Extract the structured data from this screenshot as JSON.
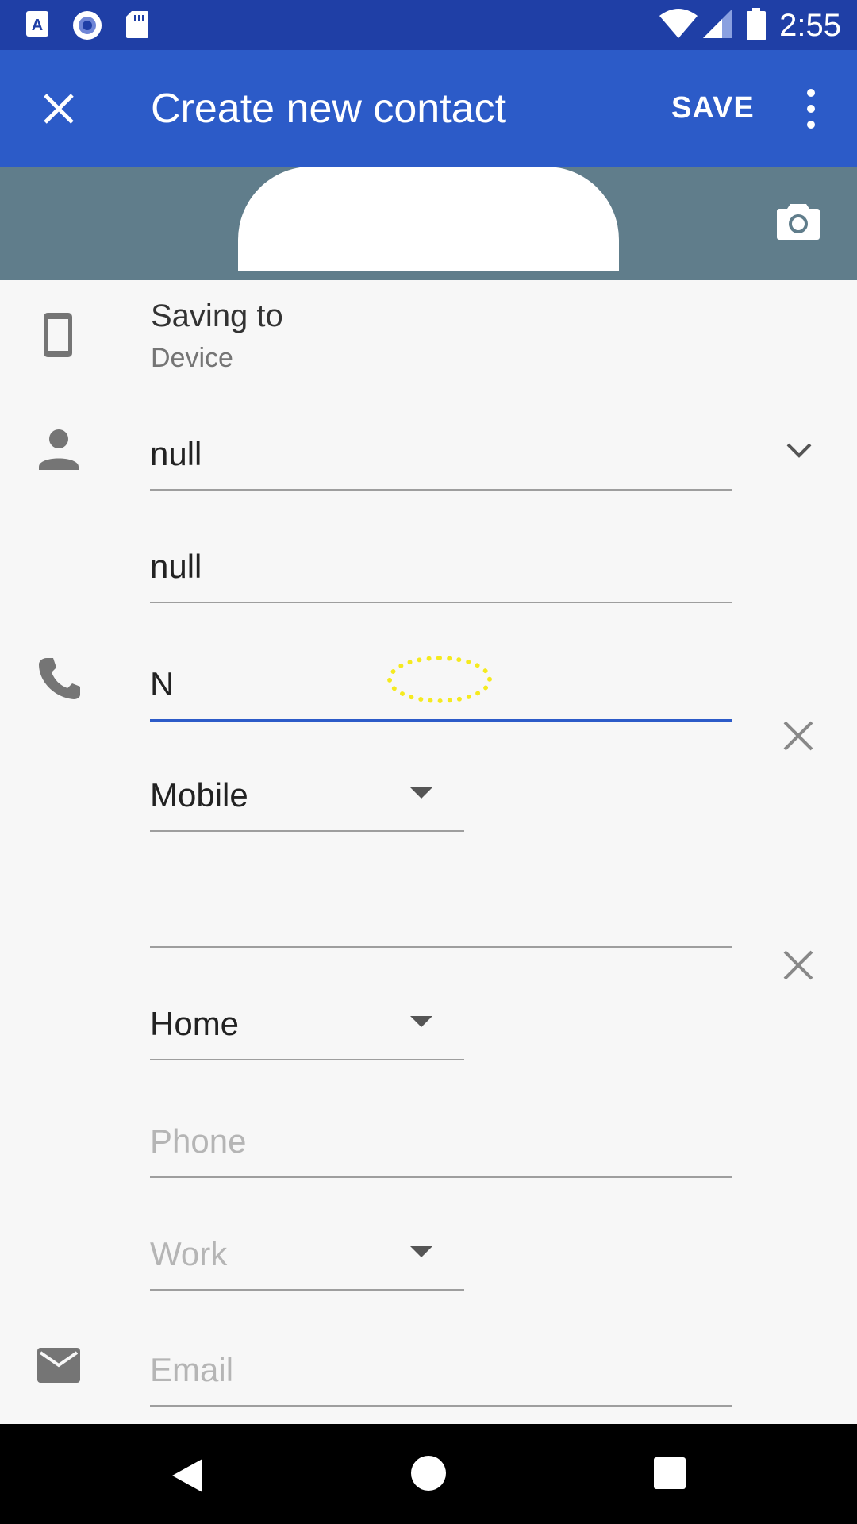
{
  "status_bar": {
    "time": "2:55",
    "icons": [
      "notification-a-icon",
      "circle-app-icon",
      "sd-card-icon",
      "wifi-icon",
      "signal-icon",
      "battery-icon"
    ]
  },
  "app_bar": {
    "close_icon": "close-icon",
    "title": "Create new contact",
    "save_label": "SAVE",
    "more_icon": "more-vert-icon"
  },
  "photo": {
    "camera_icon": "camera-icon"
  },
  "saving_to": {
    "label": "Saving to",
    "value": "Device"
  },
  "name": {
    "first_value": "null",
    "second_value": "null"
  },
  "phones": [
    {
      "value": "N",
      "type": "Mobile"
    },
    {
      "value": "",
      "type": "Home"
    },
    {
      "placeholder": "Phone",
      "type_placeholder": "Work"
    }
  ],
  "email": {
    "placeholder": "Email"
  },
  "colors": {
    "status_bar": "#1f3fa6",
    "app_bar": "#2c5bc8",
    "photo_bg": "#607d8b",
    "focus_underline": "#2c5bc8",
    "touch_indicator": "#f5ea1f"
  }
}
